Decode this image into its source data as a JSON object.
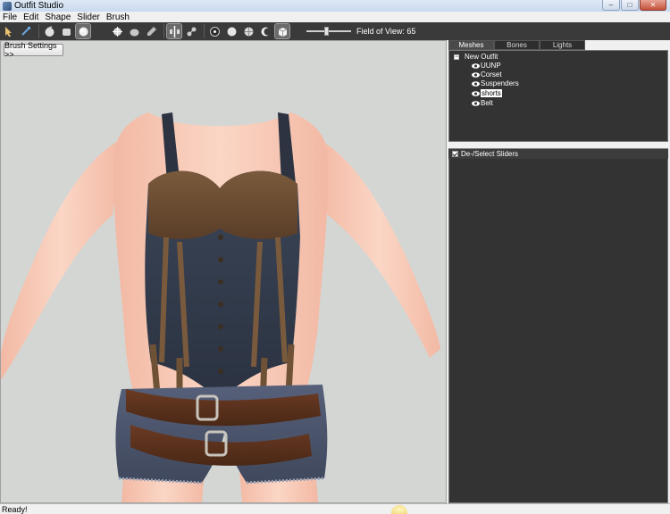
{
  "window": {
    "title": "Outfit Studio"
  },
  "menu": [
    "File",
    "Edit",
    "Shape",
    "Slider",
    "Brush"
  ],
  "toolbar": {
    "icons": [
      "select-icon",
      "transform-icon",
      "mask-brush-icon",
      "inflate-brush-icon",
      "deflate-brush-icon",
      "move-brush-icon",
      "smooth-brush-icon",
      "weight-brush-icon",
      "color-brush-icon",
      "mirror-x-icon",
      "connected-only-icon",
      "vertex-view-icon",
      "shaded-view-icon",
      "wireframe-view-icon",
      "lighting-icon",
      "texture-icon"
    ],
    "fov_label": "Field of View: 65",
    "fov_value": 65
  },
  "viewport": {
    "brush_settings_label": "Brush Settings >>"
  },
  "tabs": [
    "Meshes",
    "Bones",
    "Lights"
  ],
  "selected_tab": "Meshes",
  "mesh_tree": {
    "root": "New Outfit",
    "items": [
      {
        "label": "UUNP"
      },
      {
        "label": "Corset"
      },
      {
        "label": "Suspenders"
      },
      {
        "label": "shorts",
        "selected": true
      },
      {
        "label": "Belt"
      }
    ]
  },
  "sliders": {
    "header": "De-/Select Sliders"
  },
  "status": {
    "text": "Ready!"
  },
  "colors": {
    "panel_bg": "#333333",
    "viewport_bg": "#d4d6d4",
    "toolbar_bg": "#3a3a3a"
  }
}
